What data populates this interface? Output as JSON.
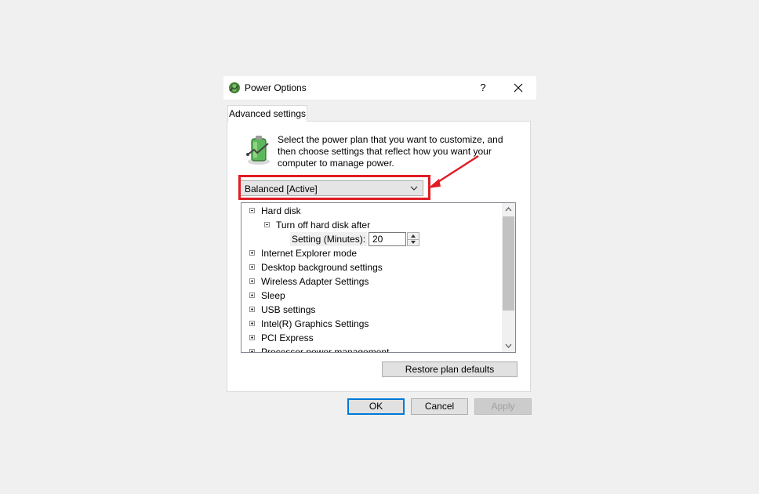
{
  "window": {
    "title": "Power Options",
    "help_label": "?",
    "icon": "power-options-icon"
  },
  "tab": {
    "label": "Advanced settings"
  },
  "description": "Select the power plan that you want to customize, and then choose settings that reflect how you want your computer to manage power.",
  "plan_select": {
    "value": "Balanced [Active]"
  },
  "tree": {
    "hard_disk": "Hard disk",
    "turn_off_hard_disk": "Turn off hard disk after",
    "setting_label": "Setting (Minutes):",
    "setting_value": "20",
    "items": [
      "Internet Explorer mode",
      "Desktop background settings",
      "Wireless Adapter Settings",
      "Sleep",
      "USB settings",
      "Intel(R) Graphics Settings",
      "PCI Express",
      "Processor power management"
    ]
  },
  "buttons": {
    "restore": "Restore plan defaults",
    "ok": "OK",
    "cancel": "Cancel",
    "apply": "Apply"
  },
  "colors": {
    "highlight": "#e01c24",
    "focus": "#0078d7"
  }
}
